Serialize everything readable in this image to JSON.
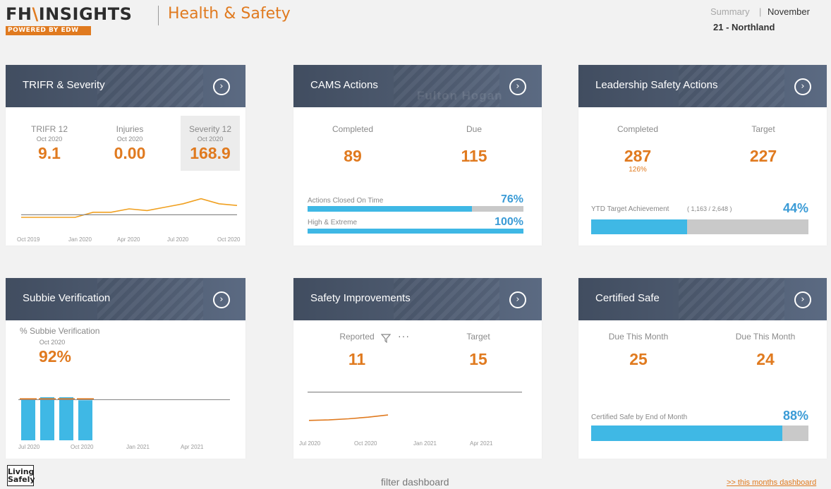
{
  "header": {
    "brand_left": "FH",
    "brand_slash": "\\",
    "brand_right": "INSIGHTS",
    "brand_sub": "POWERED BY EDW",
    "title": "Health & Safety",
    "summary": "Summary",
    "sep": "|",
    "month": "November",
    "region": "21 - Northland"
  },
  "trifr": {
    "title": "TRIFR & Severity",
    "arrow": "›",
    "metrics": [
      {
        "label": "TRIFR 12",
        "date": "Oct 2020",
        "value": "9.1"
      },
      {
        "label": "Injuries",
        "date": "Oct 2020",
        "value": "0.00"
      },
      {
        "label": "Severity 12",
        "date": "Oct 2020",
        "value": "168.9"
      }
    ],
    "xticks": [
      "Oct 2019",
      "Jan 2020",
      "Apr 2020",
      "Jul 2020",
      "Oct 2020"
    ]
  },
  "cams": {
    "title": "CAMS Actions",
    "watermark": "Fulton Hogan",
    "arrow": "›",
    "completed_label": "Completed",
    "completed": "89",
    "due_label": "Due",
    "due": "115",
    "on_time_label": "Actions Closed On Time",
    "on_time_pct": "76%",
    "on_time_frac": 0.76,
    "high_label": "High & Extreme",
    "high_pct": "100%",
    "high_frac": 1.0
  },
  "leadership": {
    "title": "Leadership Safety Actions",
    "arrow": "›",
    "completed_label": "Completed",
    "completed": "287",
    "completed_pct": "126%",
    "target_label": "Target",
    "target": "227",
    "ytd_label": "YTD Target Achievement",
    "ytd_detail": "( 1,163  /  2,648 )",
    "ytd_pct": "44%",
    "ytd_frac": 0.44
  },
  "subbie": {
    "title": "Subbie Verification",
    "arrow": "›",
    "label": "% Subbie Verification",
    "date": "Oct 2020",
    "value": "92%",
    "xticks": [
      "Jul 2020",
      "Oct 2020",
      "Jan 2021",
      "Apr 2021"
    ]
  },
  "improvements": {
    "title": "Safety Improvements",
    "arrow": "›",
    "reported_label": "Reported",
    "reported": "11",
    "target_label": "Target",
    "target": "15",
    "more": "···",
    "xticks": [
      "Jul 2020",
      "Oct 2020",
      "Jan 2021",
      "Apr 2021"
    ]
  },
  "certified": {
    "title": "Certified Safe",
    "arrow": "›",
    "left_label": "Due This Month",
    "left_value": "25",
    "right_label": "Due This Month",
    "right_value": "24",
    "bar_label": "Certified Safe by End of Month",
    "bar_pct": "88%",
    "bar_frac": 0.88
  },
  "footer": {
    "logo_line1": "Living",
    "logo_line2": "Safely",
    "filter": "filter dashboard",
    "link": ">> this months dashboard"
  },
  "chart_data": [
    {
      "type": "line",
      "x": [
        "Oct 2019",
        "Nov 2019",
        "Dec 2019",
        "Jan 2020",
        "Feb 2020",
        "Mar 2020",
        "Apr 2020",
        "May 2020",
        "Jun 2020",
        "Jul 2020",
        "Aug 2020",
        "Sep 2020",
        "Oct 2020"
      ],
      "series": [
        {
          "values": [
            5,
            5,
            5,
            5,
            8,
            8,
            10,
            9,
            11,
            13,
            16,
            13,
            12
          ],
          "color": "#f0a020"
        },
        {
          "values": [
            6.5,
            6.5,
            6.5,
            6.5,
            6.5,
            6.5,
            6.5,
            6.5,
            6.5,
            6.5,
            6.5,
            6.5,
            6.5
          ],
          "color": "#8c8c8c"
        }
      ],
      "ylim": [
        0,
        20
      ]
    },
    {
      "type": "bar",
      "categories": [
        "Jul 2020",
        "Aug 2020",
        "Sep 2020",
        "Oct 2020"
      ],
      "values": [
        94,
        99,
        99,
        92
      ],
      "target": 95,
      "ylim": [
        0,
        120
      ],
      "colors": {
        "bar": "#3fb8e5",
        "target": "#e07a1f",
        "line": "#8c8c8c"
      }
    },
    {
      "type": "line",
      "x": [
        "Jul 2020",
        "Aug 2020",
        "Sep 2020",
        "Oct 2020",
        "Nov 2020"
      ],
      "series": [
        {
          "values": [
            4,
            4.5,
            5.5,
            7,
            9
          ],
          "color": "#e07a1f"
        }
      ],
      "target_line": 30,
      "ylim": [
        0,
        35
      ]
    }
  ]
}
